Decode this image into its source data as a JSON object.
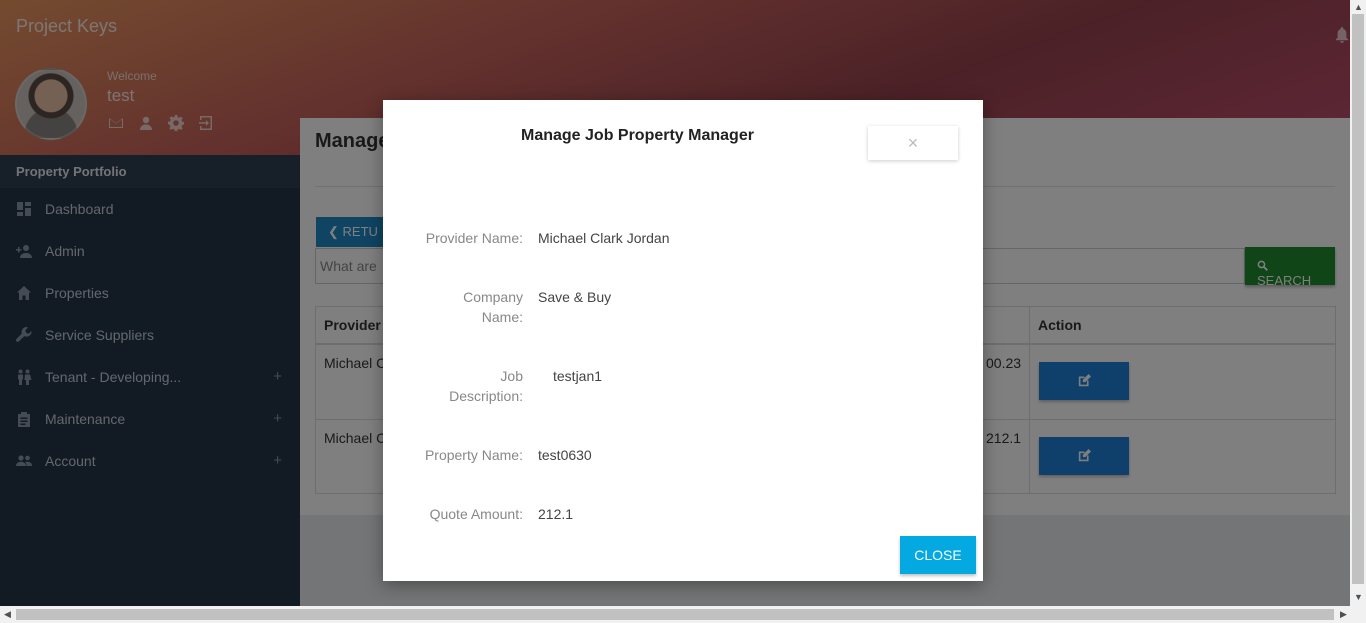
{
  "header": {
    "brand": "Project Keys",
    "welcome": "Welcome",
    "username": "test",
    "user_icons": [
      "mail-icon",
      "user-icon",
      "gear-icon",
      "logout-icon"
    ]
  },
  "sidebar": {
    "section": "Property Portfolio",
    "items": [
      {
        "label": "Dashboard",
        "icon": "dashboard-icon"
      },
      {
        "label": "Admin",
        "icon": "add-user-icon"
      },
      {
        "label": "Properties",
        "icon": "home-icon"
      },
      {
        "label": "Service Suppliers",
        "icon": "wrench-icon"
      },
      {
        "label": "Tenant - Developing...",
        "icon": "people-icon",
        "expandable": "+"
      },
      {
        "label": "Maintenance",
        "icon": "clipboard-icon",
        "expandable": "+"
      },
      {
        "label": "Account",
        "icon": "group-icon",
        "expandable": "+"
      }
    ]
  },
  "content": {
    "title": "Manage",
    "return_label": "RETU",
    "search_placeholder": "What are",
    "search_label": "SEARCH",
    "table": {
      "headers": [
        "Provider",
        "Action"
      ],
      "rows": [
        {
          "provider": "Michael C",
          "amount": "00.23"
        },
        {
          "provider": "Michael C",
          "amount": "212.1"
        }
      ]
    }
  },
  "modal": {
    "title": "Manage Job Property Manager",
    "close_x": "×",
    "fields": [
      {
        "label": "Provider Name:",
        "value": "Michael Clark Jordan"
      },
      {
        "label": "Company Name:",
        "value": "Save & Buy"
      },
      {
        "label": "Job Description:",
        "value": "testjan1"
      },
      {
        "label": "Property Name:",
        "value": "test0630"
      },
      {
        "label": "Quote Amount:",
        "value": "212.1"
      }
    ],
    "close_label": "CLOSE"
  },
  "colors": {
    "sidebar": "#243447",
    "search_button": "#1f8a2e",
    "close_button": "#03a9e0",
    "edit_button": "#1e7fd6"
  }
}
